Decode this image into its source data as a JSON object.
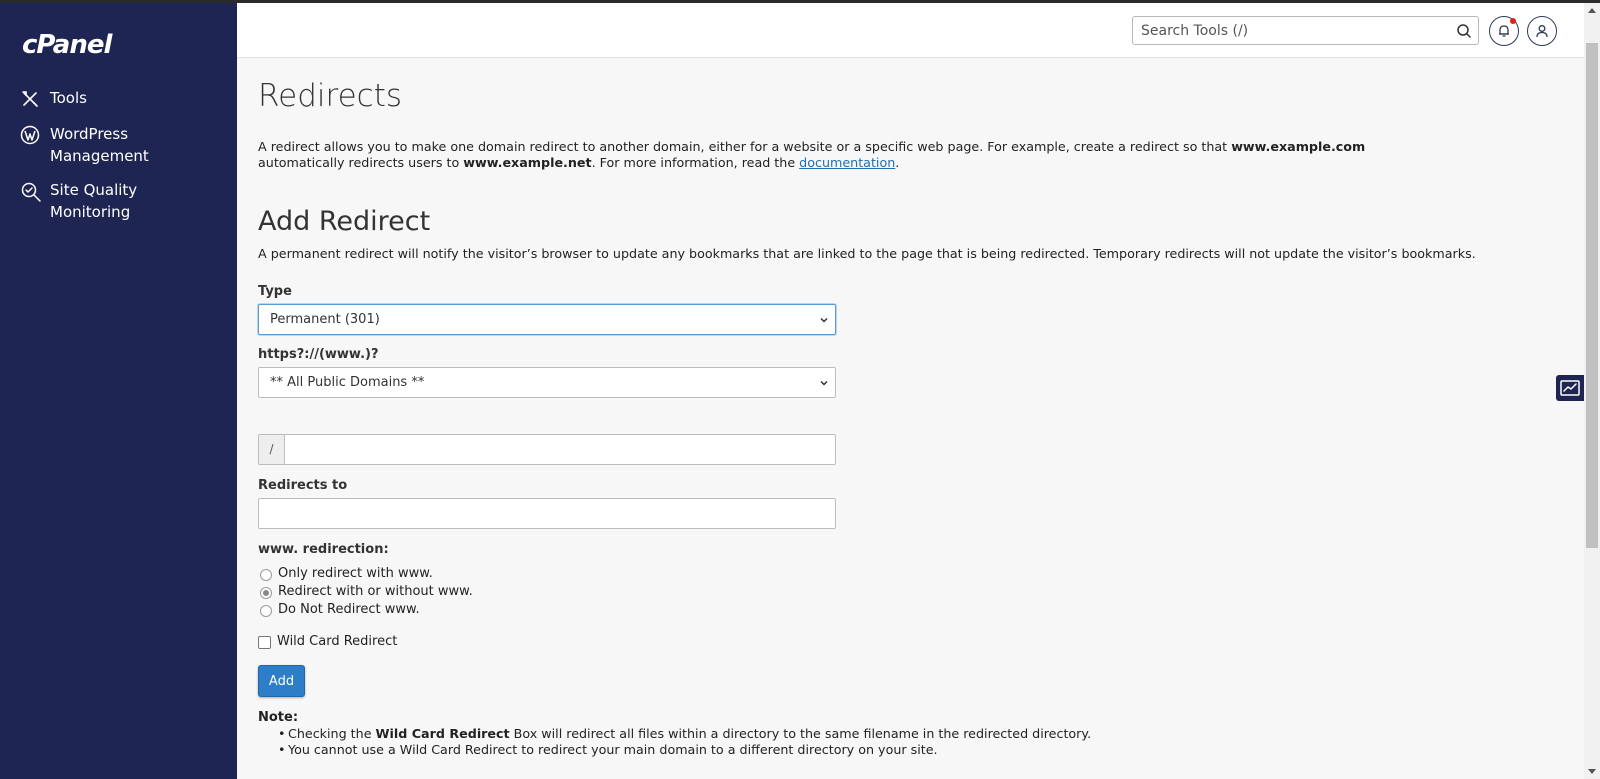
{
  "app": {
    "logo": "cPanel"
  },
  "sidebar": {
    "items": [
      {
        "label": "Tools",
        "icon": "tools-icon"
      },
      {
        "label": "WordPress Management",
        "icon": "wordpress-icon"
      },
      {
        "label": "Site Quality Monitoring",
        "icon": "site-quality-icon"
      }
    ]
  },
  "header": {
    "search_placeholder": "Search Tools (/)"
  },
  "page": {
    "title": "Redirects",
    "intro_part1": "A redirect allows you to make one domain redirect to another domain, either for a website or a specific web page. For example, create a redirect so that ",
    "intro_domain1": "www.example.com",
    "intro_part2": " automatically redirects users to ",
    "intro_domain2": "www.example.net",
    "intro_part3": ". For more information, read the ",
    "intro_link": "documentation",
    "intro_end": "."
  },
  "form": {
    "heading": "Add Redirect",
    "description": "A permanent redirect will notify the visitor’s browser to update any bookmarks that are linked to the page that is being redirected. Temporary redirects will not update the visitor’s bookmarks.",
    "type_label": "Type",
    "type_value": "Permanent (301)",
    "domain_label": "https?://(www.)?",
    "domain_value": "** All Public Domains **",
    "path_prefix": "/",
    "path_value": "",
    "redirects_to_label": "Redirects to",
    "redirects_to_value": "",
    "www_label": "www. redirection:",
    "www_options": [
      {
        "label": "Only redirect with www.",
        "checked": false
      },
      {
        "label": "Redirect with or without www.",
        "checked": true
      },
      {
        "label": "Do Not Redirect www.",
        "checked": false
      }
    ],
    "wildcard_label": "Wild Card Redirect",
    "wildcard_checked": false,
    "add_button": "Add"
  },
  "note": {
    "title": "Note:",
    "item1_part1": "Checking the ",
    "item1_bold": "Wild Card Redirect",
    "item1_part2": " Box will redirect all files within a directory to the same filename in the redirected directory.",
    "item2": "You cannot use a Wild Card Redirect to redirect your main domain to a different directory on your site."
  },
  "colors": {
    "sidebar_bg": "#1f2552",
    "accent": "#2e7dc9",
    "link": "#1d6fb5",
    "notification_dot": "#e0201e"
  }
}
